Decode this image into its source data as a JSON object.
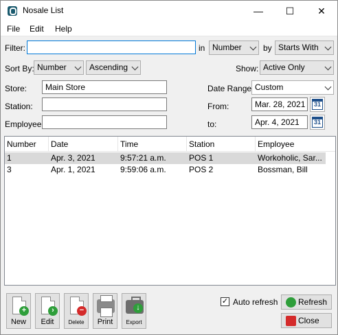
{
  "window": {
    "title": "Nosale List",
    "minimize": "—",
    "maximize": "☐",
    "close": "✕"
  },
  "menu": [
    "File",
    "Edit",
    "Help"
  ],
  "filter": {
    "label": "Filter:",
    "value": "",
    "in_label": "in",
    "in_value": "Number",
    "by_label": "by",
    "by_value": "Starts With"
  },
  "sort": {
    "label": "Sort By:",
    "field": "Number",
    "order": "Ascending"
  },
  "show": {
    "label": "Show:",
    "value": "Active Only"
  },
  "store": {
    "label": "Store:",
    "value": "Main Store"
  },
  "station": {
    "label": "Station:",
    "value": ""
  },
  "employee": {
    "label": "Employee:",
    "value": ""
  },
  "date_range": {
    "label": "Date Range:",
    "value": "Custom",
    "from_label": "From:",
    "from_value": "Mar. 28, 2021",
    "to_label": "to:",
    "to_value": "Apr. 4, 2021",
    "calendar_glyph": "31"
  },
  "table": {
    "columns": [
      "Number",
      "Date",
      "Time",
      "Station",
      "Employee"
    ],
    "rows": [
      [
        "1",
        "Apr. 3, 2021",
        "9:57:21 a.m.",
        "POS 1",
        "Workoholic, Sar..."
      ],
      [
        "3",
        "Apr. 1, 2021",
        "9:59:06 a.m.",
        "POS 2",
        "Bossman, Bill"
      ]
    ]
  },
  "toolbar": {
    "new": "New",
    "edit": "Edit",
    "delete": "Delete",
    "print": "Print",
    "export": "Export"
  },
  "auto_refresh": {
    "label": "Auto refresh",
    "checked": true,
    "mark": "✓"
  },
  "buttons": {
    "refresh": "Refresh",
    "close": "Close"
  },
  "colors": {
    "accent": "#0078d7",
    "selected_row": "#d9d9d9",
    "green": "#2e9e3a",
    "red": "#d42a2a"
  },
  "icons": {
    "new": "new-document-icon",
    "edit": "edit-document-icon",
    "delete": "delete-document-icon",
    "print": "printer-icon",
    "export": "export-briefcase-icon",
    "refresh": "refresh-icon",
    "close": "close-x-icon",
    "calendar": "calendar-icon"
  }
}
